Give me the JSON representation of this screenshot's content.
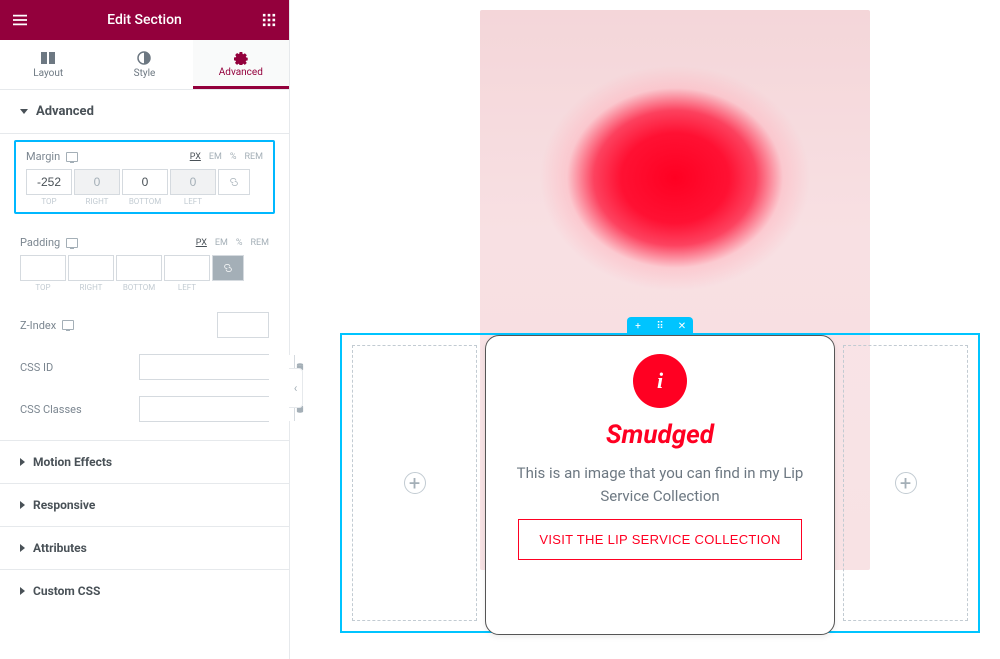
{
  "panel": {
    "title": "Edit Section",
    "tabs": {
      "layout": "Layout",
      "style": "Style",
      "advanced": "Advanced"
    },
    "section_title": "Advanced",
    "margin": {
      "label": "Margin",
      "units": {
        "px": "PX",
        "em": "EM",
        "pct": "%",
        "rem": "REM"
      },
      "top": "-252",
      "right": "0",
      "bottom": "0",
      "left": "0",
      "legends": {
        "top": "TOP",
        "right": "RIGHT",
        "bottom": "BOTTOM",
        "left": "LEFT"
      }
    },
    "padding": {
      "label": "Padding",
      "units": {
        "px": "PX",
        "em": "EM",
        "pct": "%",
        "rem": "REM"
      },
      "top": "",
      "right": "",
      "bottom": "",
      "left": "",
      "legends": {
        "top": "TOP",
        "right": "RIGHT",
        "bottom": "BOTTOM",
        "left": "LEFT"
      }
    },
    "zindex": {
      "label": "Z-Index",
      "value": ""
    },
    "cssid": {
      "label": "CSS ID",
      "value": ""
    },
    "cssclasses": {
      "label": "CSS Classes",
      "value": ""
    },
    "accordion": {
      "motion": "Motion Effects",
      "responsive": "Responsive",
      "attributes": "Attributes",
      "customcss": "Custom CSS"
    }
  },
  "handle": {
    "add": "+",
    "close": "✕"
  },
  "placeholder": {
    "plus": "+"
  },
  "card": {
    "icon_letter": "i",
    "title": "Smudged",
    "desc": "This is an image that you can find in my Lip Service Collection",
    "button": "VISIT THE LIP SERVICE COLLECTION"
  }
}
